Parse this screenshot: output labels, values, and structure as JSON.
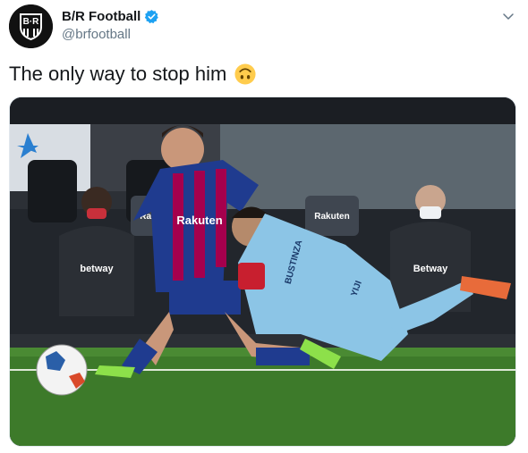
{
  "author": {
    "name": "B/R Football",
    "handle": "@brfootball",
    "avatar_text": "B·R",
    "verified": true
  },
  "tweet": {
    "text": "The only way to stop him"
  },
  "media": {
    "sign_text_1": "Rakuten",
    "sign_text_2": "Rakuten",
    "shirt_sponsor_left": "Rakuten",
    "player_name": "BUSTINZA",
    "player_name_2": "YIJI",
    "shirt_sponsor_right": "betway",
    "staff_sponsor_left": "betway",
    "staff_sponsor_right": "Betway"
  },
  "colors": {
    "verified_blue": "#1da1f2",
    "handle_gray": "#657786",
    "pitch_green": "#3d7a2a",
    "barca_blue": "#1f3b8f",
    "barca_red": "#a5004d",
    "leganes_blue": "#8cc5e6"
  }
}
